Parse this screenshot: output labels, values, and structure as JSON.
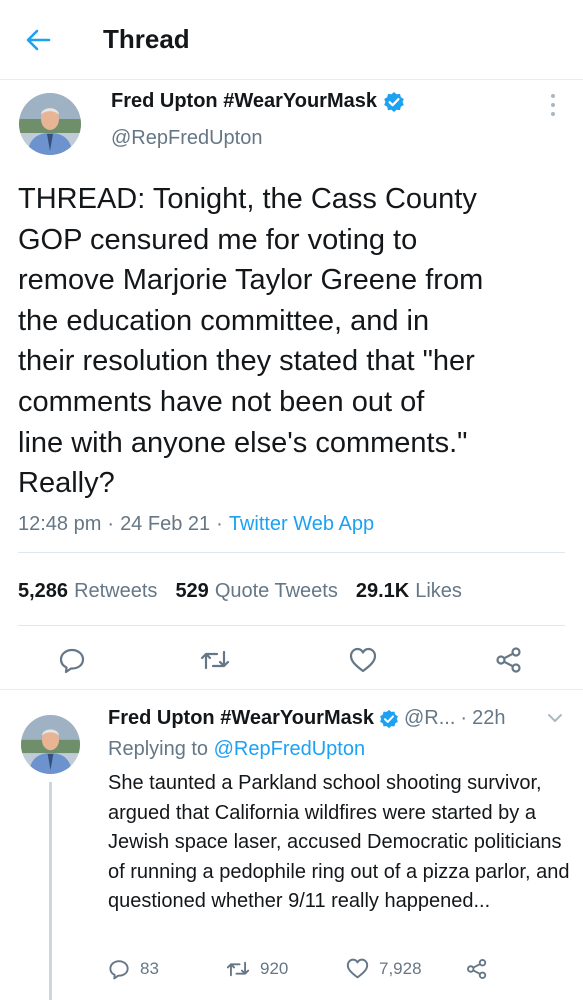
{
  "header": {
    "title": "Thread"
  },
  "main_tweet": {
    "display_name": "Fred Upton #WearYourMask",
    "handle": "@RepFredUpton",
    "text": "THREAD: Tonight, the Cass County\nGOP censured me for voting to\nremove Marjorie Taylor Greene from\nthe education committee, and in\ntheir resolution they stated that \"her\ncomments have not been out of\nline with anyone else's comments.\"\nReally?",
    "time": "12:48 pm",
    "date": "24 Feb 21",
    "source": "Twitter Web App",
    "retweets_count": "5,286",
    "retweets_label": "Retweets",
    "quotes_count": "529",
    "quotes_label": "Quote Tweets",
    "likes_count": "29.1K",
    "likes_label": "Likes"
  },
  "reply_tweet": {
    "display_name": "Fred Upton #WearYourMask",
    "handle_truncated": "@R...",
    "age": "22h",
    "replying_prefix": "Replying to",
    "replying_to": "@RepFredUpton",
    "text": "She taunted a Parkland school shooting survivor, argued that California wildfires were started by a Jewish space laser, accused Democratic politicians of running a pedophile ring out of a pizza parlor, and questioned whether 9/11 really happened...",
    "replies": "83",
    "retweets": "920",
    "likes": "7,928"
  },
  "icons": {
    "back": "arrow-left-icon",
    "verified": "verified-badge-icon",
    "more": "more-vertical-icon",
    "reply": "reply-icon",
    "retweet": "retweet-icon",
    "like": "heart-icon",
    "share": "share-icon",
    "chevron": "chevron-down-icon"
  },
  "colors": {
    "accent": "#1da1f2",
    "text": "#14171a",
    "secondary": "#657786",
    "divider": "#e6ecf0"
  }
}
